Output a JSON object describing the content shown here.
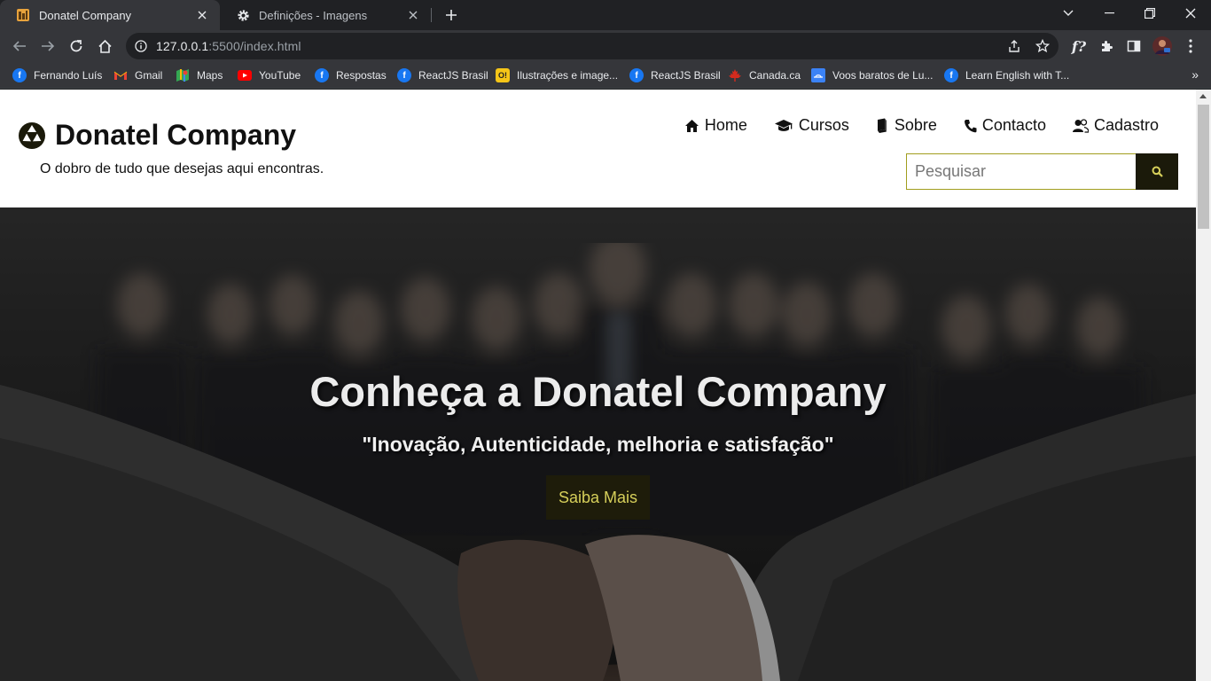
{
  "browser": {
    "tabs": [
      {
        "title": "Donatel Company",
        "favicon": "site-favicon",
        "active": true
      },
      {
        "title": "Definições - Imagens",
        "favicon": "gear-icon",
        "active": false
      }
    ],
    "url_host": "127.0.0.1",
    "url_rest": ":5500/index.html",
    "bookmarks": [
      {
        "label": "Fernando Luís",
        "icon": "facebook-icon",
        "color": "#1877f2"
      },
      {
        "label": "Gmail",
        "icon": "gmail-icon",
        "color": "#ea4335"
      },
      {
        "label": "Maps",
        "icon": "maps-icon",
        "color": "#34a853"
      },
      {
        "label": "YouTube",
        "icon": "youtube-icon",
        "color": "#ff0000"
      },
      {
        "label": "Respostas",
        "icon": "facebook-icon",
        "color": "#1877f2"
      },
      {
        "label": "ReactJS Brasil",
        "icon": "facebook-icon",
        "color": "#1877f2"
      },
      {
        "label": "Ilustrações e image...",
        "icon": "ouch-icon",
        "color": "#f5c518"
      },
      {
        "label": "ReactJS Brasil",
        "icon": "facebook-icon",
        "color": "#1877f2"
      },
      {
        "label": "Canada.ca",
        "icon": "maple-leaf-icon",
        "color": "#d52b1e"
      },
      {
        "label": "Voos baratos de Lu...",
        "icon": "flights-icon",
        "color": "#3b82f6"
      },
      {
        "label": "Learn English with T...",
        "icon": "facebook-icon",
        "color": "#1877f2"
      }
    ]
  },
  "site": {
    "brand": "Donatel Company",
    "tagline": "O dobro de tudo que desejas aqui encontras.",
    "nav": [
      {
        "label": "Home",
        "icon": "home-icon"
      },
      {
        "label": "Cursos",
        "icon": "graduation-cap-icon"
      },
      {
        "label": "Sobre",
        "icon": "book-icon"
      },
      {
        "label": "Contacto",
        "icon": "phone-icon"
      },
      {
        "label": "Cadastro",
        "icon": "users-icon"
      }
    ],
    "search_placeholder": "Pesquisar",
    "hero_title": "Conheça a Donatel Company",
    "hero_motto": "\"Inovação, Autenticidade, melhoria e satisfação\"",
    "hero_cta": "Saiba Mais",
    "colors": {
      "accent": "#d6cf5a",
      "dark": "#1b1a0a",
      "search_border": "#a19d1e"
    }
  }
}
